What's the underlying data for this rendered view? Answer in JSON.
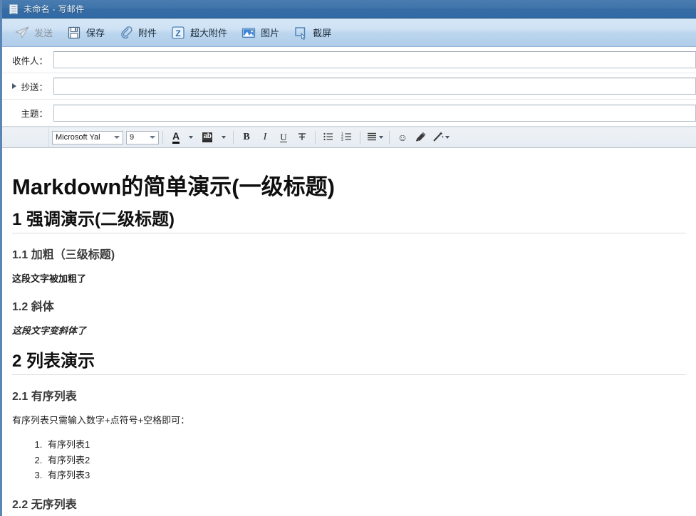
{
  "window": {
    "title": "未命名 - 写邮件",
    "icon": "document-icon",
    "accent": "#3f75ab",
    "left_border_color": "#5a85b5"
  },
  "toolbar": {
    "buttons": [
      {
        "label": "发送",
        "icon": "send-icon",
        "disabled": true
      },
      {
        "label": "保存",
        "icon": "save-icon",
        "disabled": false
      },
      {
        "label": "附件",
        "icon": "paperclip-icon",
        "disabled": false
      },
      {
        "label": "超大附件",
        "icon": "big-attachment-icon",
        "disabled": false
      },
      {
        "label": "图片",
        "icon": "picture-icon",
        "disabled": false
      },
      {
        "label": "截屏",
        "icon": "screenshot-icon",
        "disabled": false
      }
    ]
  },
  "fields": [
    {
      "label": "收件人：",
      "value": "",
      "placeholder": "",
      "has_expander": false,
      "name": "recipient"
    },
    {
      "label": "抄送：",
      "value": "",
      "placeholder": "",
      "has_expander": true,
      "name": "cc"
    },
    {
      "label": "主题：",
      "value": "",
      "placeholder": "",
      "has_expander": false,
      "name": "subject"
    }
  ],
  "format_bar": {
    "font_family": "Microsoft Yal",
    "font_size": "9",
    "font_color_glyph": "A",
    "highlight_glyph": "ab",
    "bold": "B",
    "italic": "I",
    "underline": "U",
    "strikethrough": "S",
    "bullet_list": "bullet-list-icon",
    "numbered_list": "numbered-list-icon",
    "align": "align-icon",
    "emoji": "☺",
    "signature": "signature-icon",
    "magic": "magic-wand-icon"
  },
  "document": {
    "blocks": [
      {
        "type": "h1",
        "text": "Markdown的简单演示(一级标题)"
      },
      {
        "type": "h2",
        "text": "1 强调演示(二级标题)"
      },
      {
        "type": "h3",
        "text": "1.1 加粗（三级标题)"
      },
      {
        "type": "p-bold",
        "text": "这段文字被加粗了"
      },
      {
        "type": "h3",
        "text": "1.2 斜体"
      },
      {
        "type": "p-italic",
        "text": "这段文字变斜体了"
      },
      {
        "type": "h2",
        "text": "2 列表演示"
      },
      {
        "type": "h3",
        "text": "2.1 有序列表"
      },
      {
        "type": "p",
        "text": "有序列表只需输入数字+点符号+空格即可："
      },
      {
        "type": "ol",
        "items": [
          "有序列表1",
          "有序列表2",
          "有序列表3"
        ]
      },
      {
        "type": "h2-cut",
        "text": "2.2 无序列表"
      }
    ]
  }
}
